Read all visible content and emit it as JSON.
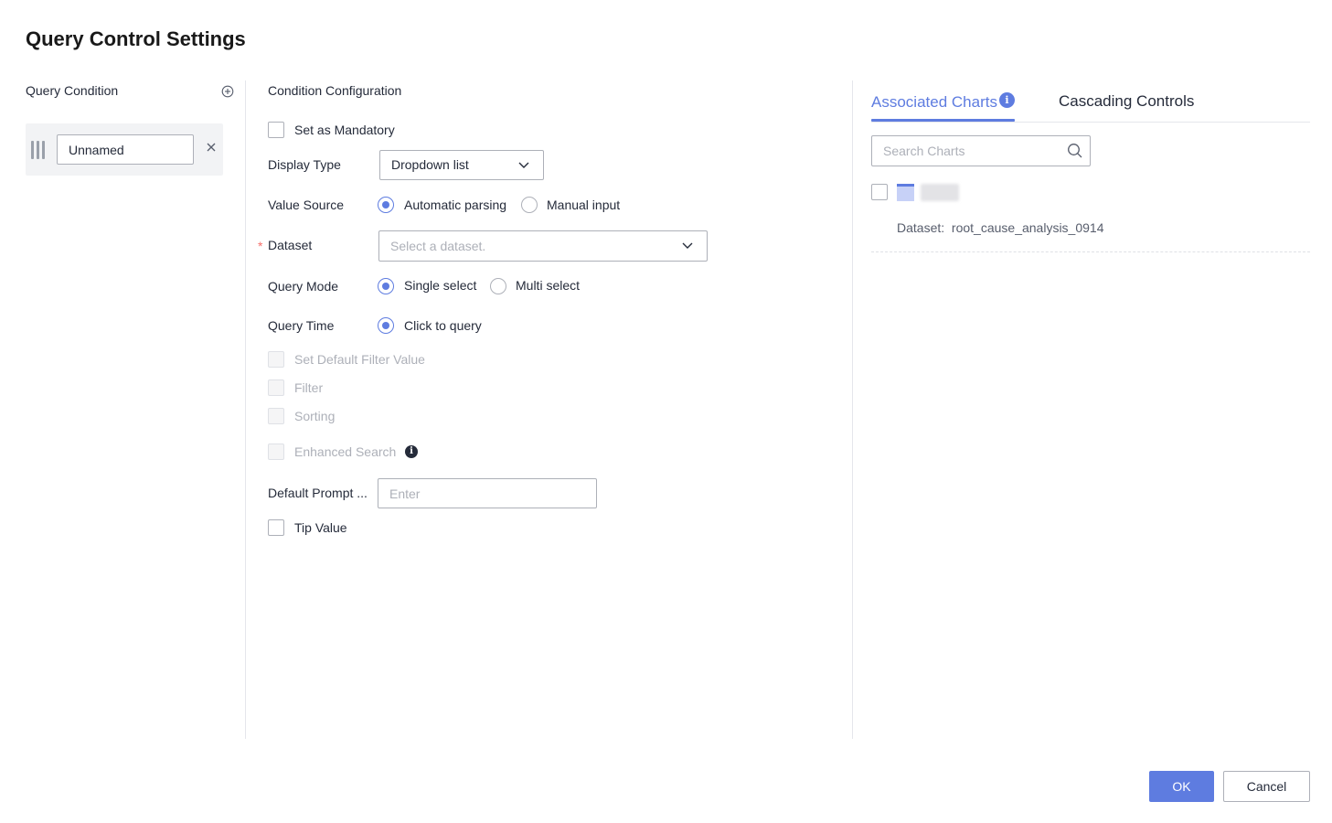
{
  "dialog": {
    "title": "Query Control Settings"
  },
  "left_panel": {
    "label": "Query Condition",
    "items": [
      {
        "name": "Unnamed"
      }
    ]
  },
  "middle_panel": {
    "label": "Condition Configuration",
    "set_mandatory_label": "Set as Mandatory",
    "display_type": {
      "label": "Display Type",
      "value": "Dropdown list"
    },
    "value_source": {
      "label": "Value Source",
      "options": [
        "Automatic parsing",
        "Manual input"
      ],
      "selected": "Automatic parsing"
    },
    "dataset": {
      "label": "Dataset",
      "required_mark": "*",
      "placeholder": "Select a dataset."
    },
    "query_mode": {
      "label": "Query Mode",
      "options": [
        "Single select",
        "Multi select"
      ],
      "selected": "Single select"
    },
    "query_time": {
      "label": "Query Time",
      "options": [
        "Click to query"
      ],
      "selected": "Click to query"
    },
    "set_default_filter_label": "Set Default Filter Value",
    "filter_label": "Filter",
    "sorting_label": "Sorting",
    "enhanced_search_label": "Enhanced Search",
    "default_prompt": {
      "label": "Default Prompt ...",
      "placeholder": "Enter"
    },
    "tip_value_label": "Tip Value"
  },
  "right_panel": {
    "tabs": [
      {
        "label": "Associated Charts",
        "active": true
      },
      {
        "label": "Cascading Controls",
        "active": false
      }
    ],
    "search_placeholder": "Search Charts",
    "charts": [
      {
        "dataset_label": "Dataset:",
        "dataset_value": "root_cause_analysis_0914"
      }
    ]
  },
  "footer": {
    "ok_label": "OK",
    "cancel_label": "Cancel"
  },
  "icons": {
    "add": "add-circle-icon",
    "drag": "drag-handle-icon",
    "remove": "close-icon",
    "dropdown": "chevron-down-icon",
    "search": "search-icon",
    "info": "info-icon",
    "chart": "table-chart-icon"
  },
  "colors": {
    "accent": "#5e7ce0",
    "required": "#f66f6a",
    "text": "#252b3a",
    "disabled_text": "#adb0b8"
  }
}
